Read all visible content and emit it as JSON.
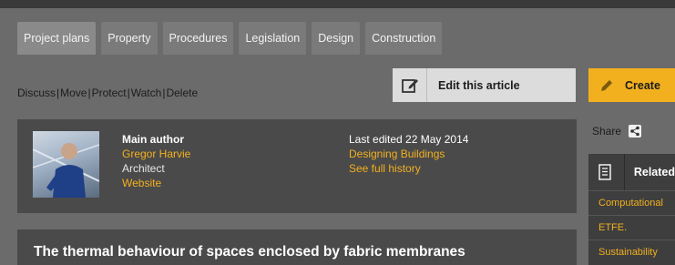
{
  "tabs": [
    {
      "label": "Project plans"
    },
    {
      "label": "Property"
    },
    {
      "label": "Procedures"
    },
    {
      "label": "Legislation"
    },
    {
      "label": "Design"
    },
    {
      "label": "Construction"
    }
  ],
  "actions": {
    "discuss": "Discuss",
    "move": "Move",
    "protect": "Protect",
    "watch": "Watch",
    "delete": "Delete"
  },
  "edit_button": {
    "label": "Edit this article",
    "icon": "edit-icon"
  },
  "create_button": {
    "label": "Create",
    "icon": "pencil-icon",
    "color": "#f2b01f"
  },
  "author": {
    "label": "Main author",
    "name": "Gregor Harvie",
    "role": "Architect",
    "website": "Website"
  },
  "edit_info": {
    "last_edited": "Last edited 22 May 2014",
    "edited_by": "Designing Buildings",
    "history": "See full history"
  },
  "share": {
    "label": "Share",
    "icon": "share-icon"
  },
  "related": {
    "label": "Related",
    "icon": "document-icon",
    "items": [
      "Computational",
      "ETFE.",
      "Sustainability"
    ]
  },
  "article": {
    "title": "The thermal behaviour of spaces enclosed by fabric membranes"
  },
  "colors": {
    "accent": "#f2b01f",
    "panel": "#4a4a4a",
    "background": "#6b6b6b"
  }
}
